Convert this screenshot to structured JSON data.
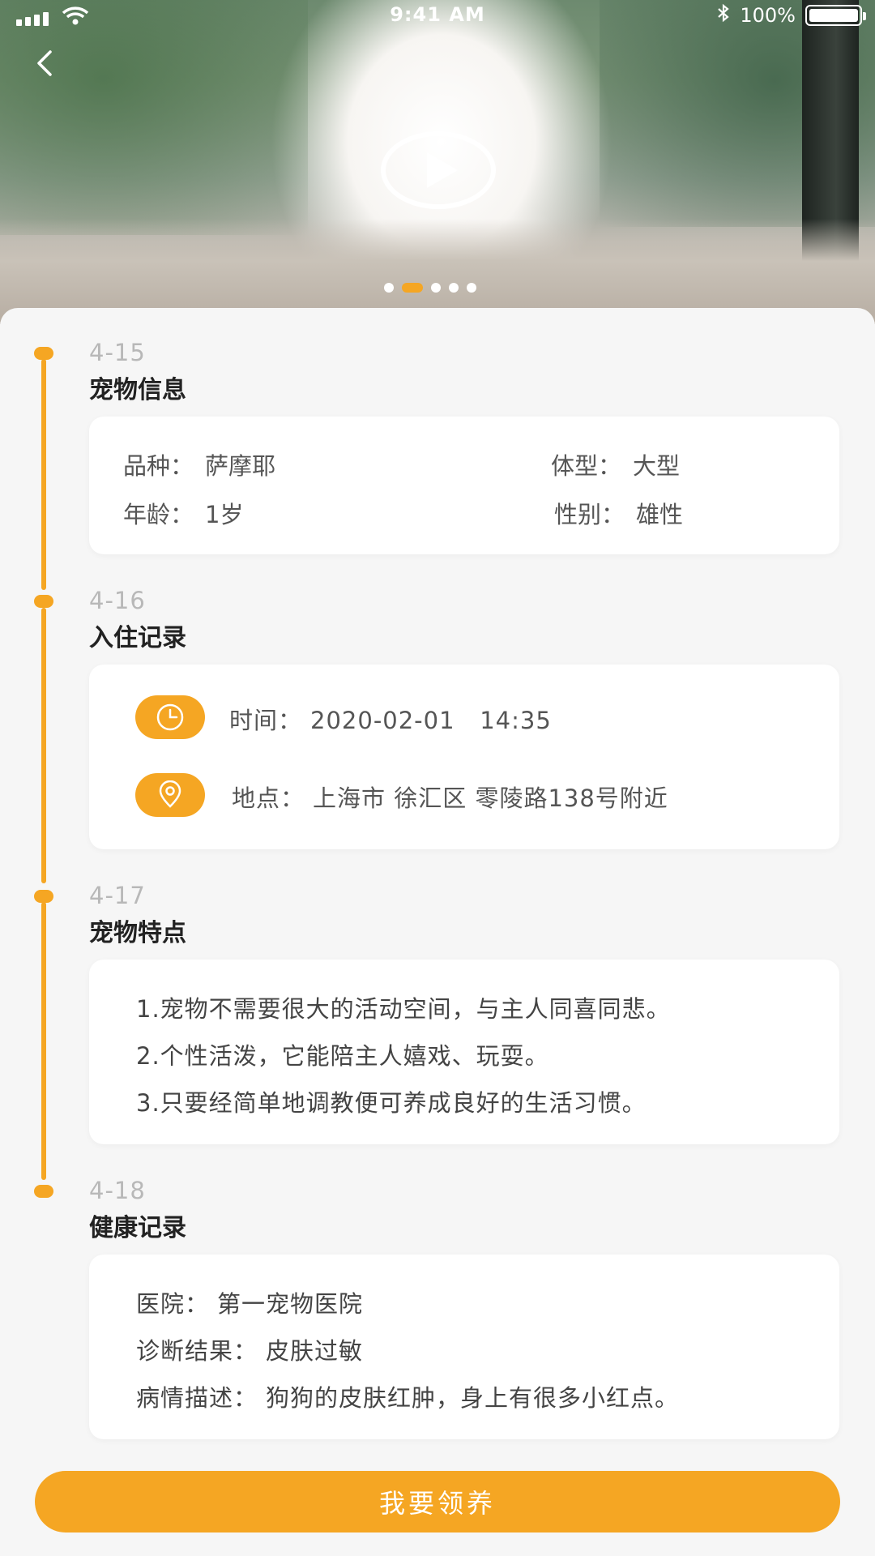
{
  "status_bar": {
    "time": "9:41 AM",
    "battery": "100%",
    "bluetooth_icon": "bluetooth-icon",
    "signal_icon": "cellular-signal-icon",
    "wifi_icon": "wifi-icon"
  },
  "hero": {
    "back_icon": "chevron-left-icon",
    "play_icon": "play-icon",
    "pager": {
      "count": 5,
      "active_index": 1
    }
  },
  "sections": [
    {
      "date": "4-15",
      "title": "宠物信息",
      "fields": {
        "breed_label": "品种：",
        "breed_value": "萨摩耶",
        "size_label": "体型：",
        "size_value": "大型",
        "age_label": "年龄：",
        "age_value": "1岁",
        "gender_label": "性别：",
        "gender_value": "雄性"
      }
    },
    {
      "date": "4-16",
      "title": "入住记录",
      "time_label": "时间：",
      "time_value": "2020-02-01   14:35",
      "location_label": "地点：",
      "location_value": "上海市 徐汇区 零陵路138号附近",
      "time_icon": "clock-icon",
      "location_icon": "location-pin-icon"
    },
    {
      "date": "4-17",
      "title": "宠物特点",
      "lines": [
        "1.宠物不需要很大的活动空间，与主人同喜同悲。",
        "2.个性活泼，它能陪主人嬉戏、玩耍。",
        "3.只要经简单地调教便可养成良好的生活习惯。"
      ]
    },
    {
      "date": "4-18",
      "title": "健康记录",
      "hospital_label": "医院：",
      "hospital_value": "第一宠物医院",
      "diagnosis_label": "诊断结果：",
      "diagnosis_value": "皮肤过敏",
      "description_label": "病情描述：",
      "description_value": "狗狗的皮肤红肿，身上有很多小红点。"
    }
  ],
  "adopt_button": {
    "label": "我要领养"
  },
  "colors": {
    "accent": "#f5a623",
    "background": "#f6f6f6",
    "card": "#ffffff"
  }
}
